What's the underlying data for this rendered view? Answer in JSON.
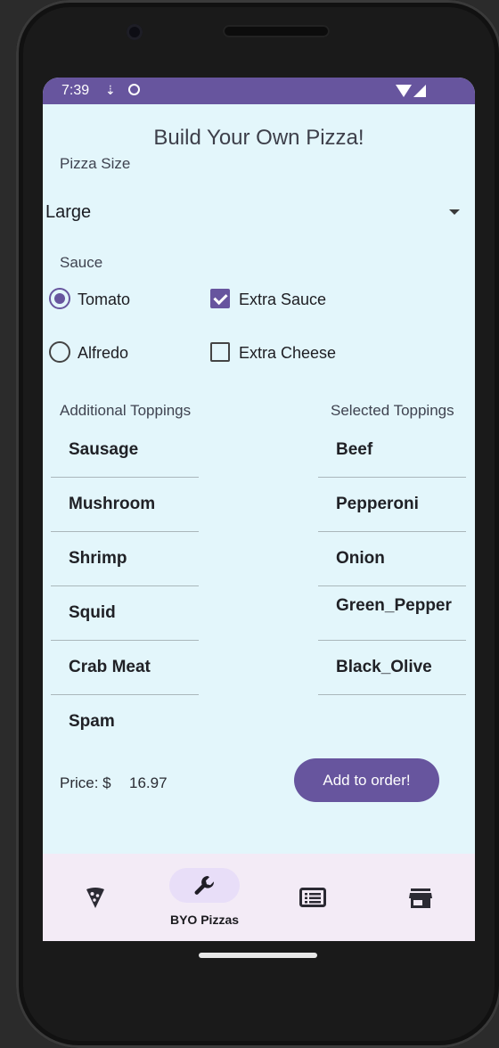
{
  "status": {
    "time": "7:39"
  },
  "page": {
    "title": "Build Your Own Pizza!"
  },
  "size": {
    "label": "Pizza Size",
    "selected": "Large"
  },
  "sauce": {
    "label": "Sauce",
    "tomato": "Tomato",
    "alfredo": "Alfredo",
    "selected": "Tomato"
  },
  "extras": {
    "extra_sauce": "Extra Sauce",
    "extra_cheese": "Extra Cheese",
    "extra_sauce_checked": true,
    "extra_cheese_checked": false
  },
  "toppings": {
    "available_label": "Additional Toppings",
    "selected_label": "Selected Toppings",
    "available": [
      "Sausage",
      "Mushroom",
      "Shrimp",
      "Squid",
      "Crab Meat",
      "Spam"
    ],
    "selected": [
      "Beef",
      "Pepperoni",
      "Onion",
      "Green_Pepper",
      "Black_Olive"
    ]
  },
  "price": {
    "label": "Price: $",
    "value": "16.97"
  },
  "add_button": "Add to order!",
  "nav": {
    "items": [
      {
        "icon": "pizza-slice-icon",
        "label": ""
      },
      {
        "icon": "wrench-icon",
        "label": "BYO Pizzas"
      },
      {
        "icon": "order-list-icon",
        "label": ""
      },
      {
        "icon": "store-icon",
        "label": ""
      }
    ],
    "active": "BYO Pizzas"
  },
  "colors": {
    "accent": "#67559e",
    "background": "#e3f6fb",
    "nav_bg": "#f3ebf6"
  }
}
